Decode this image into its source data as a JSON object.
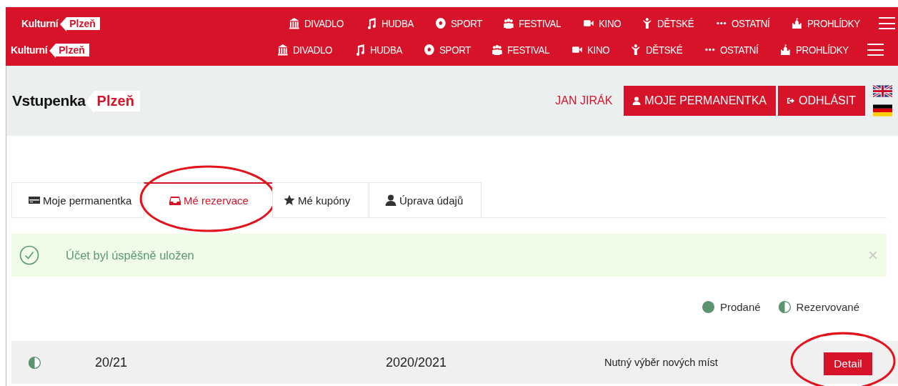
{
  "nav_bars": [
    {
      "logo": {
        "text": "Kulturní",
        "tag": "Plzeň"
      },
      "items": [
        "DIVADLO",
        "HUDBA",
        "SPORT",
        "FESTIVAL",
        "KINO",
        "DĚTSKÉ",
        "OSTATNÍ",
        "PROHLÍDKY"
      ]
    },
    {
      "logo": {
        "text": "Kulturní",
        "tag": "Plzeň"
      },
      "items": [
        "DIVADLO",
        "HUDBA",
        "SPORT",
        "FESTIVAL",
        "KINO",
        "DĚTSKÉ",
        "OSTATNÍ",
        "PROHLÍDKY"
      ]
    }
  ],
  "header": {
    "logo": {
      "text": "Vstupenka",
      "tag": "Plzeň"
    },
    "user": "JAN JIRÁK",
    "buttons": [
      "MOJE PERMANENTKA",
      "ODHLÁSIT"
    ],
    "languages": [
      {
        "kind": "en"
      },
      {
        "kind": "de"
      }
    ]
  },
  "tabs": [
    {
      "label": "Moje permanentka",
      "selected": false,
      "highlighted": false
    },
    {
      "label": "Mé rezervace",
      "selected": true,
      "highlighted": true
    },
    {
      "label": "Mé kupóny",
      "selected": false,
      "highlighted": false
    },
    {
      "label": "Úprava údajů",
      "selected": false,
      "highlighted": false
    }
  ],
  "alert": {
    "message": "Účet byl úspěšně uložen",
    "close": "×"
  },
  "legend": [
    {
      "kind": "sold",
      "label": "Prodané"
    },
    {
      "kind": "reserved",
      "label": "Rezervované"
    }
  ],
  "rows": [
    {
      "kind": "reserved",
      "code": "20/21",
      "season": "2020/2021",
      "note": "Nutný výběr nových míst",
      "button": "Detail",
      "highlighted": true
    }
  ]
}
